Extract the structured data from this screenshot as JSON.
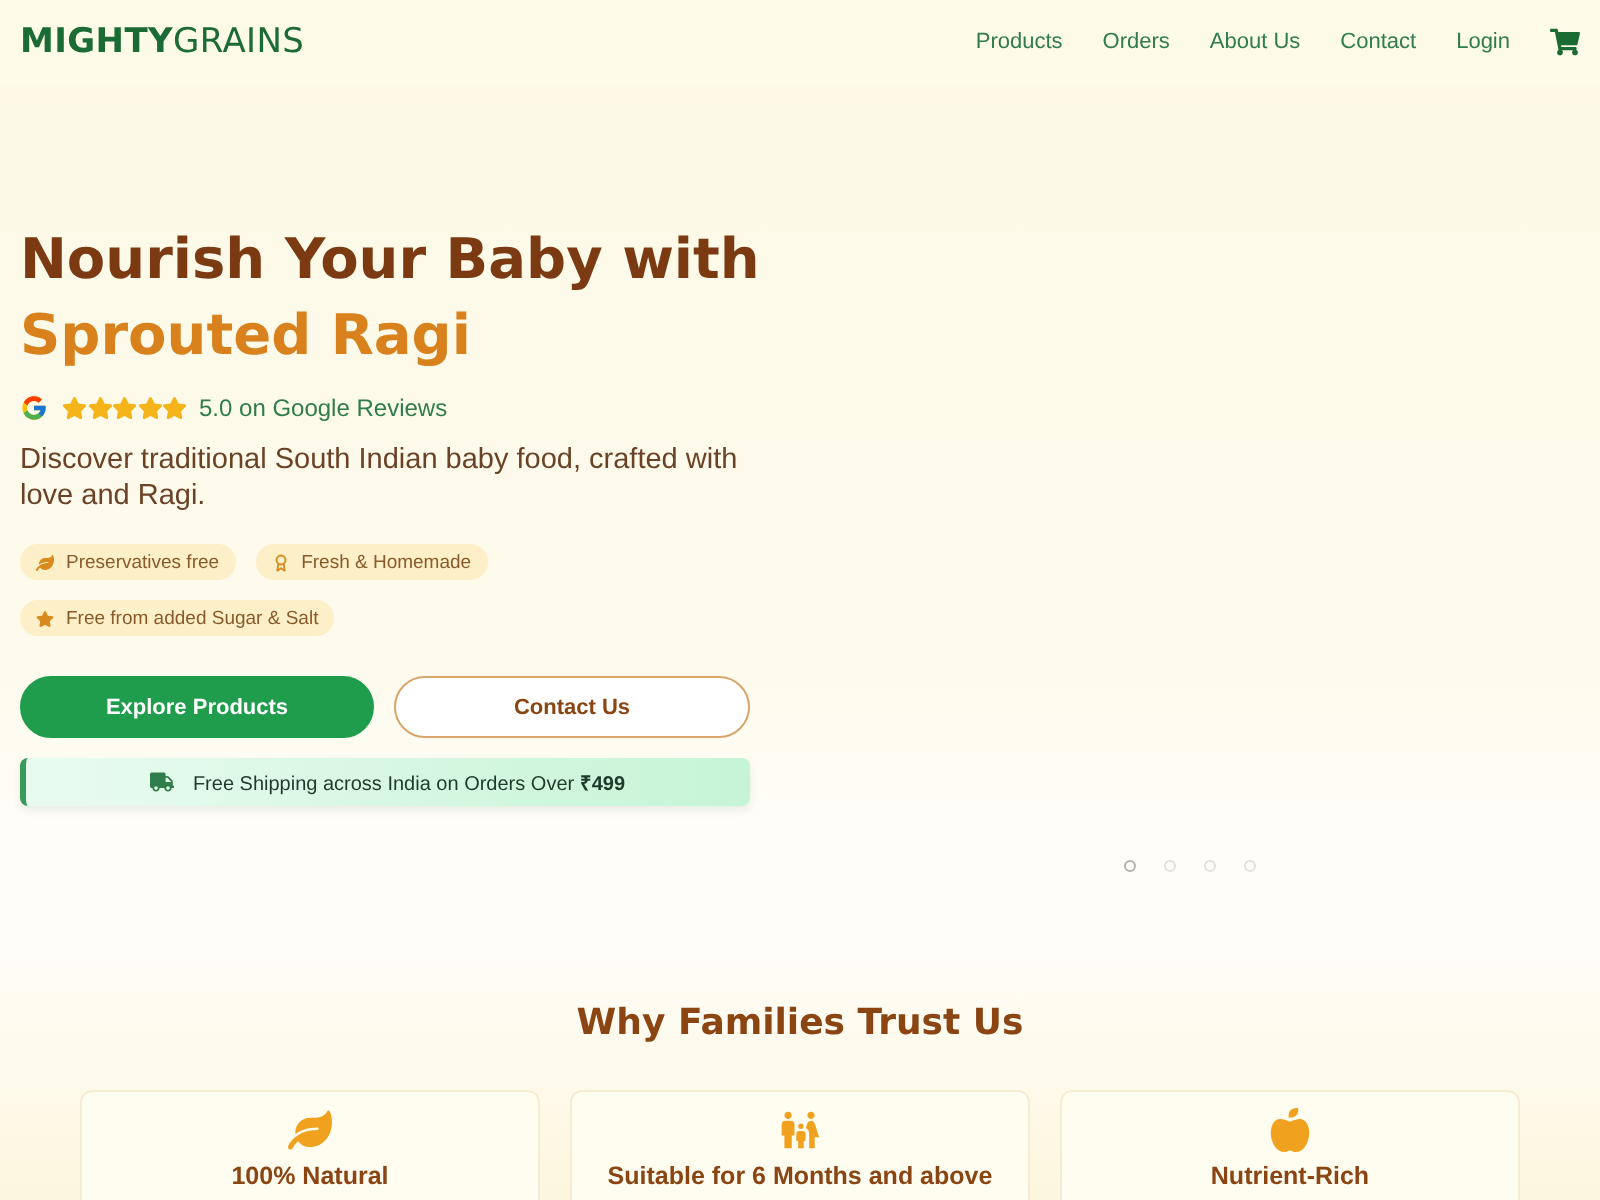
{
  "header": {
    "logo": "**MIGHTY**GRAINS",
    "nav": [
      "Products",
      "Orders",
      "About Us",
      "Contact",
      "Login"
    ]
  },
  "hero": {
    "title": "Nourish Your Baby with",
    "highlight": "Sprouted Ragi",
    "rating": {
      "stars": 5,
      "text": "5.0 on Google Reviews"
    },
    "description": "Discover traditional South Indian baby food, crafted with love and Ragi.",
    "badges": [
      {
        "kind": "leaf",
        "label": "Preservatives free"
      },
      {
        "kind": "award",
        "label": "Fresh & Homemade"
      },
      {
        "kind": "star",
        "label": "Free from added Sugar & Salt"
      }
    ],
    "buttons": [
      {
        "kind": "primary",
        "label": "Explore Products"
      },
      {
        "kind": "outline",
        "label": "Contact Us"
      }
    ],
    "shipping": "Free Shipping across India on Orders Over **₹499**",
    "carousel": {
      "dots": [
        {
          "selected": true
        },
        {
          "selected": false
        },
        {
          "selected": false
        },
        {
          "selected": false
        }
      ]
    }
  },
  "features": {
    "title": "Why Families Trust Us",
    "items": [
      {
        "kind": "leaf",
        "title": "100% Natural"
      },
      {
        "kind": "family",
        "title": "Suitable for 6 Months and above"
      },
      {
        "kind": "apple",
        "title": "Nutrient-Rich"
      }
    ]
  }
}
